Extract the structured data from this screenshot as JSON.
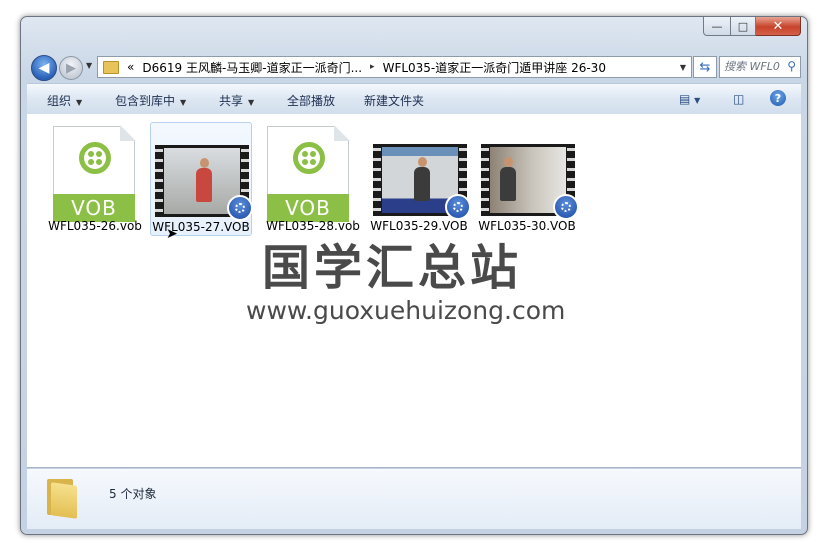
{
  "window": {
    "minimize_glyph": "—",
    "maximize_glyph": "□",
    "close_glyph": "✕"
  },
  "nav": {
    "history_glyph": "▼",
    "address": {
      "chevron": "«",
      "crumbs": [
        "D6619 王风麟-马玉卿-道家正一派奇门...",
        "WFL035-道家正一派奇门遁甲讲座 26-30"
      ],
      "separator": "▸",
      "dropdown_glyph": "▼"
    },
    "search_placeholder": "搜索 WFL0..."
  },
  "toolbar": {
    "organize": "组织",
    "include_in_library": "包含到库中",
    "share": "共享",
    "play_all": "全部播放",
    "new_folder": "新建文件夹",
    "menu_arrow": "▼"
  },
  "files": [
    {
      "name": "WFL035-26.vob",
      "kind": "VOB",
      "badge_text": "VOB"
    },
    {
      "name": "WFL035-27.VOB",
      "kind": "video"
    },
    {
      "name": "WFL035-28.vob",
      "kind": "VOB",
      "badge_text": "VOB"
    },
    {
      "name": "WFL035-29.VOB",
      "kind": "video"
    },
    {
      "name": "WFL035-30.VOB",
      "kind": "video"
    }
  ],
  "watermark": {
    "chinese": "国学汇总站",
    "url": "www.guoxuehuizong.com"
  },
  "details": {
    "item_count": "5 个对象"
  },
  "colors": {
    "vob_green": "#8bbf45",
    "titlebar": "#c9d6e6",
    "close_red": "#c7432a"
  }
}
